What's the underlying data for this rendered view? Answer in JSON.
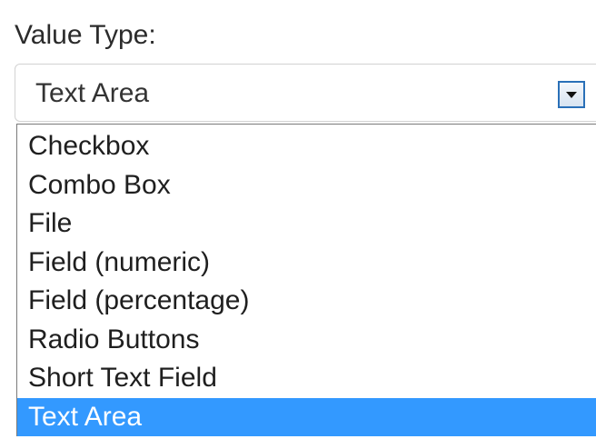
{
  "field": {
    "label": "Value Type:",
    "selected_value": "Text Area",
    "arrow_icon": "chevron-down-icon"
  },
  "colors": {
    "selected_highlight": "#3399ff",
    "arrow_border": "#2a70b8"
  },
  "options": [
    {
      "label": "Checkbox",
      "selected": false
    },
    {
      "label": "Combo Box",
      "selected": false
    },
    {
      "label": "File",
      "selected": false
    },
    {
      "label": "Field (numeric)",
      "selected": false
    },
    {
      "label": "Field (percentage)",
      "selected": false
    },
    {
      "label": "Radio Buttons",
      "selected": false
    },
    {
      "label": "Short Text Field",
      "selected": false
    },
    {
      "label": "Text Area",
      "selected": true
    }
  ]
}
